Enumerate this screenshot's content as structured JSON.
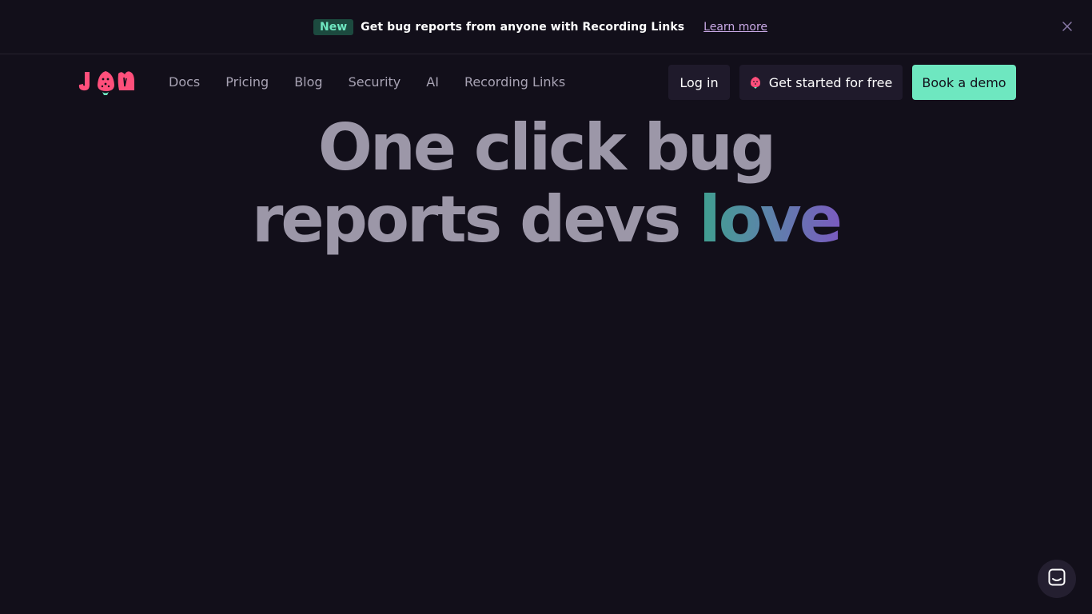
{
  "banner": {
    "badge": "New",
    "text": "Get bug reports from anyone with Recording Links",
    "link": "Learn more",
    "close_icon": "close-icon"
  },
  "nav": {
    "logo_icon": "jam-logo-icon",
    "links": [
      "Docs",
      "Pricing",
      "Blog",
      "Security",
      "AI",
      "Recording Links"
    ],
    "login": "Log in",
    "get_started": "Get started for free",
    "get_started_icon": "strawberry-icon",
    "book_demo": "Book a demo"
  },
  "hero": {
    "line1": "One click bug",
    "line2_plain": "reports devs ",
    "line2_highlight": "love"
  },
  "chat": {
    "icon": "chat-icon"
  },
  "colors": {
    "background": "#120f1a",
    "accent": "#6ee7c0",
    "logo_pink": "#ff4f7b",
    "badge_bg": "#1c4a3f"
  }
}
